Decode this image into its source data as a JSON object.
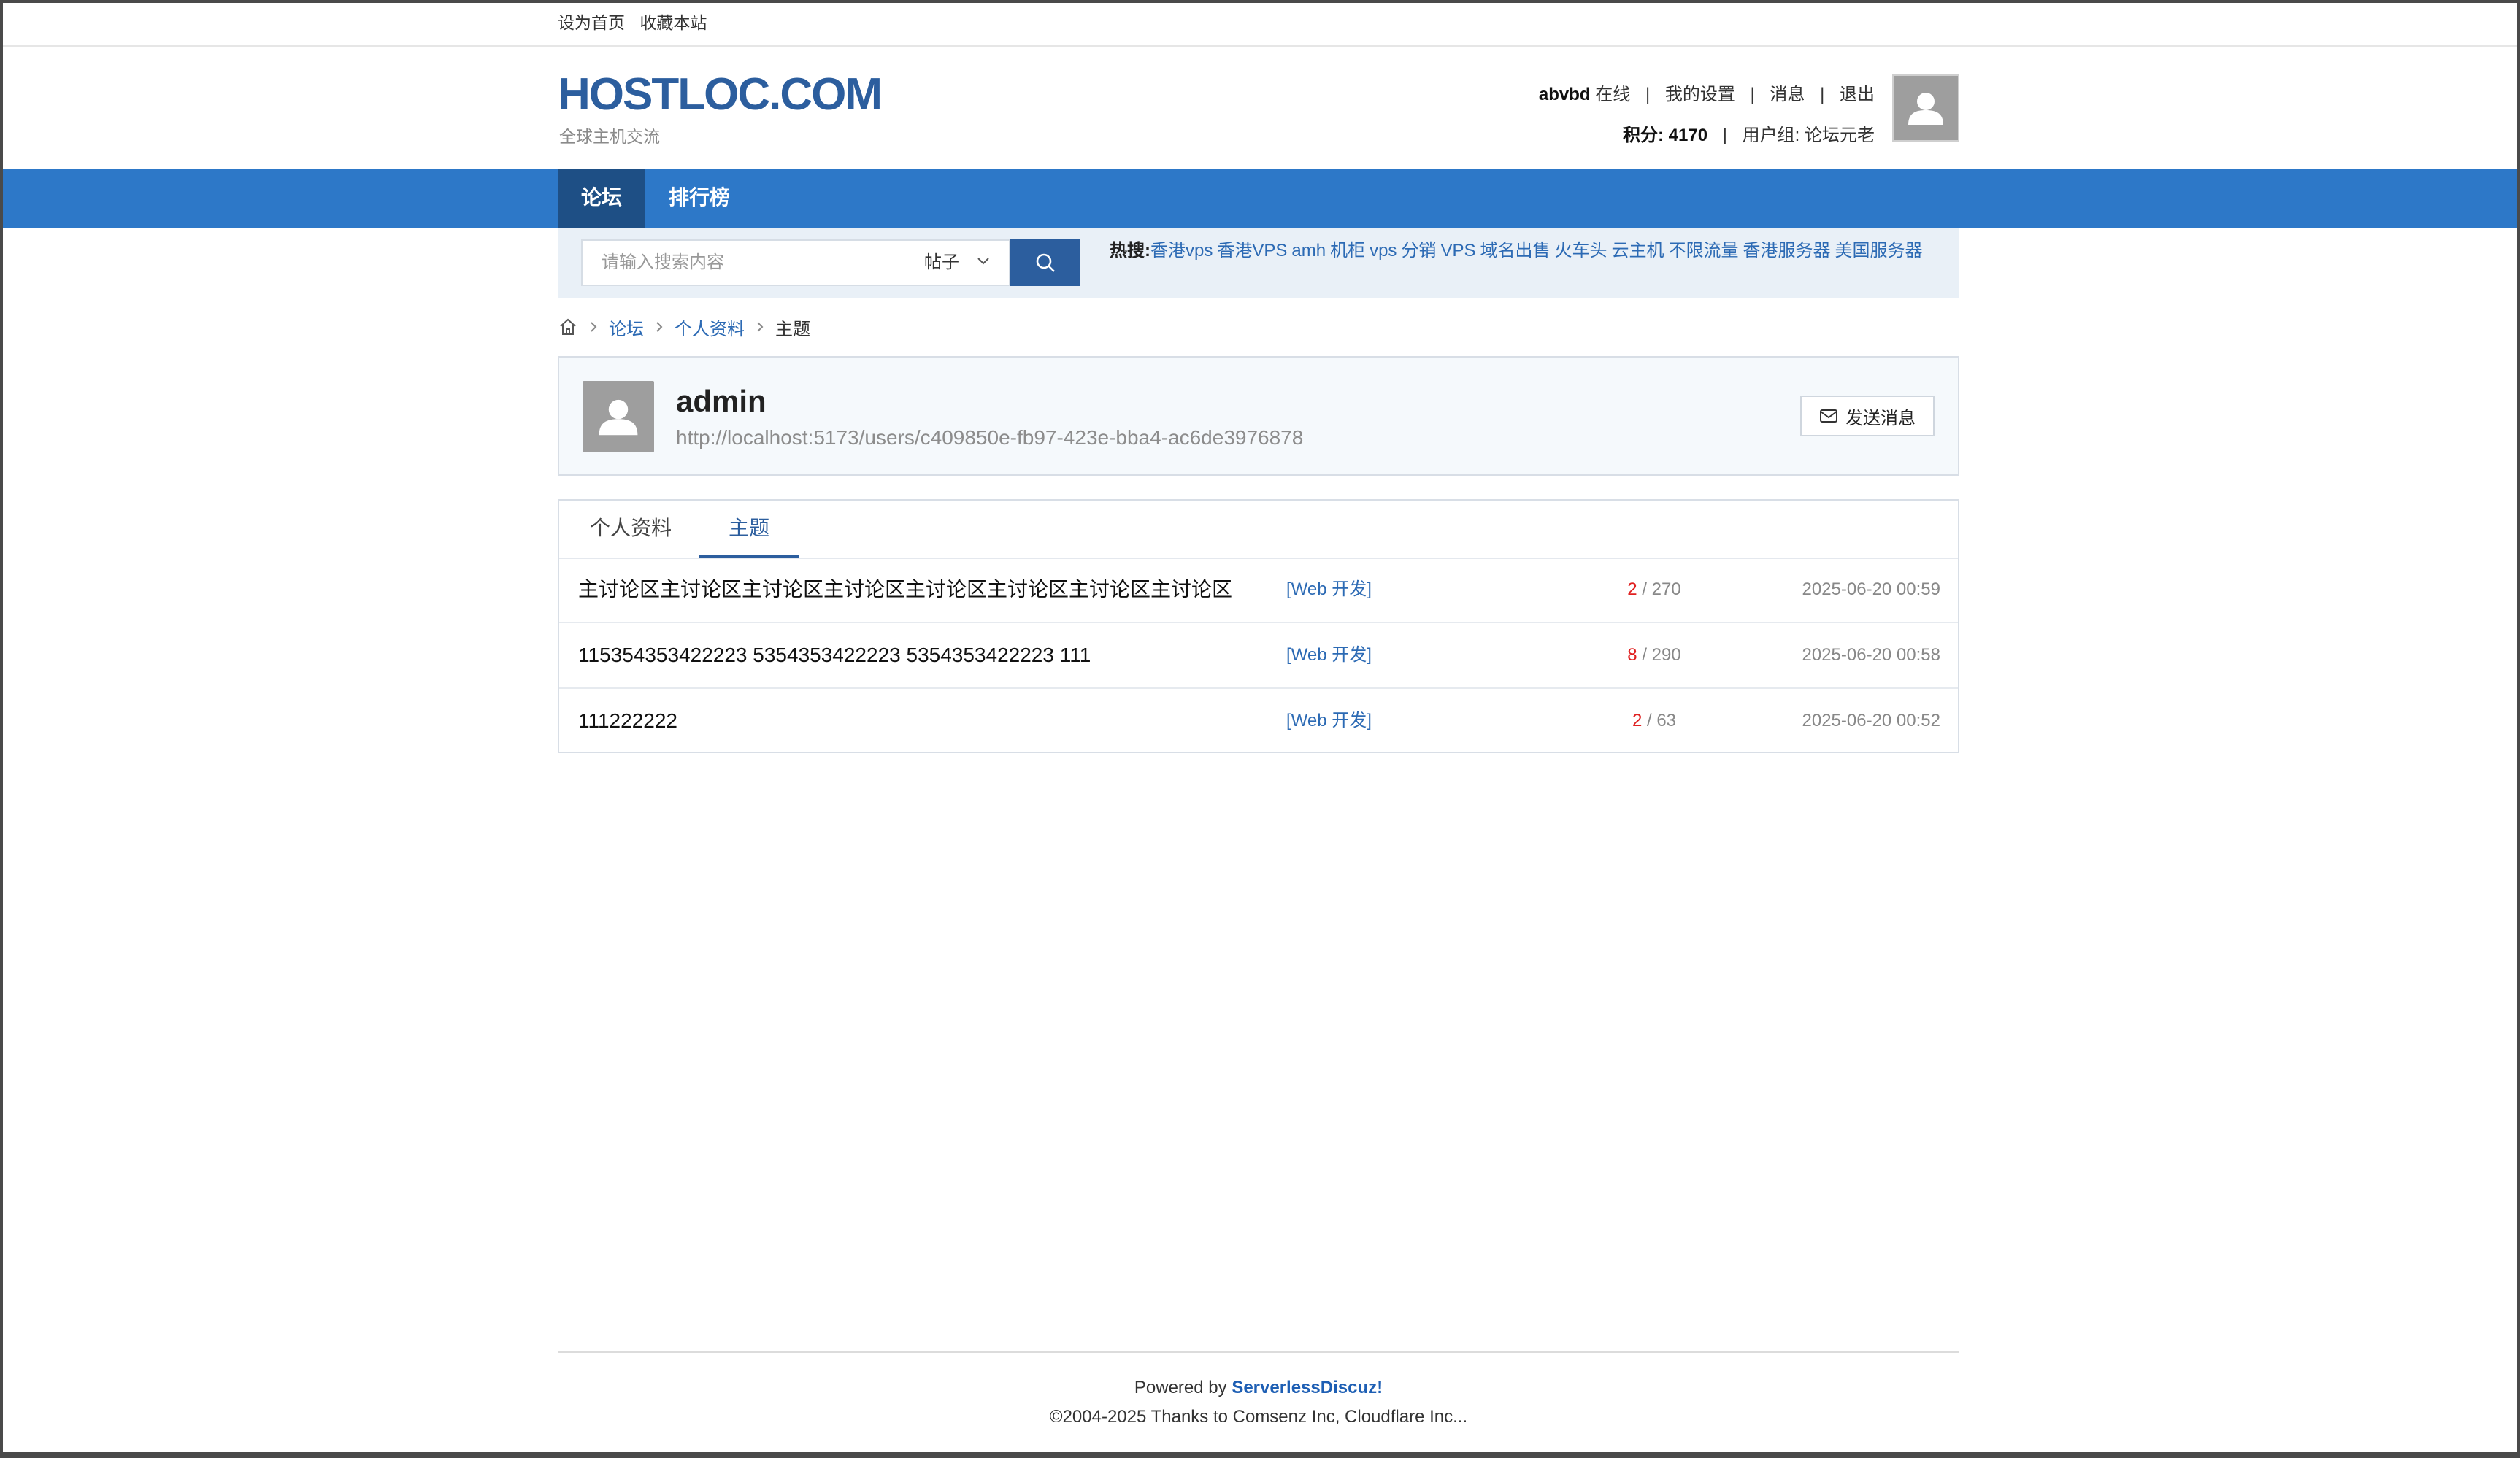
{
  "topbar": {
    "set_home": "设为首页",
    "bookmark": "收藏本站"
  },
  "header": {
    "logo": "HOSTLOC.COM",
    "tagline": "全球主机交流",
    "username": "abvbd",
    "status": "在线",
    "settings": "我的设置",
    "messages": "消息",
    "logout": "退出",
    "points_label": "积分: 4170",
    "group_label": "用户组: 论坛元老"
  },
  "nav": {
    "items": [
      {
        "label": "论坛",
        "active": true
      },
      {
        "label": "排行榜",
        "active": false
      }
    ]
  },
  "search": {
    "placeholder": "请输入搜索内容",
    "type": "帖子",
    "hot_label": "热搜:",
    "hot_terms": [
      "香港vps",
      "香港VPS",
      "amh",
      "机柜",
      "vps",
      "分销",
      "VPS",
      "域名出售",
      "火车头",
      "云主机",
      "不限流量",
      "香港服务器",
      "美国服务器"
    ]
  },
  "breadcrumb": {
    "items": [
      "论坛",
      "个人资料"
    ],
    "current": "主题"
  },
  "profile": {
    "name": "admin",
    "url": "http://localhost:5173/users/c409850e-fb97-423e-bba4-ac6de3976878",
    "send_message": "发送消息"
  },
  "tabs": [
    {
      "label": "个人资料",
      "active": false
    },
    {
      "label": "主题",
      "active": true
    }
  ],
  "threads": [
    {
      "title": "主讨论区主讨论区主讨论区主讨论区主讨论区主讨论区主讨论区主讨论区",
      "category": "[Web 开发]",
      "replies": "2",
      "views": "/ 270",
      "date": "2025-06-20 00:59"
    },
    {
      "title": "115354353422223 5354353422223 5354353422223 111",
      "category": "[Web 开发]",
      "replies": "8",
      "views": "/ 290",
      "date": "2025-06-20 00:58"
    },
    {
      "title": "111222222",
      "category": "[Web 开发]",
      "replies": "2",
      "views": "/ 63",
      "date": "2025-06-20 00:52"
    }
  ],
  "footer": {
    "powered_prefix": "Powered by",
    "powered_brand": "ServerlessDiscuz!",
    "copyright": "©2004-2025 Thanks to Comsenz Inc, Cloudflare Inc..."
  },
  "colors": {
    "nav": "#2d78c8",
    "nav_active": "#1e4f85",
    "brand": "#2c5e9e",
    "link": "#2c6ab4",
    "reply_count": "#e02020"
  }
}
